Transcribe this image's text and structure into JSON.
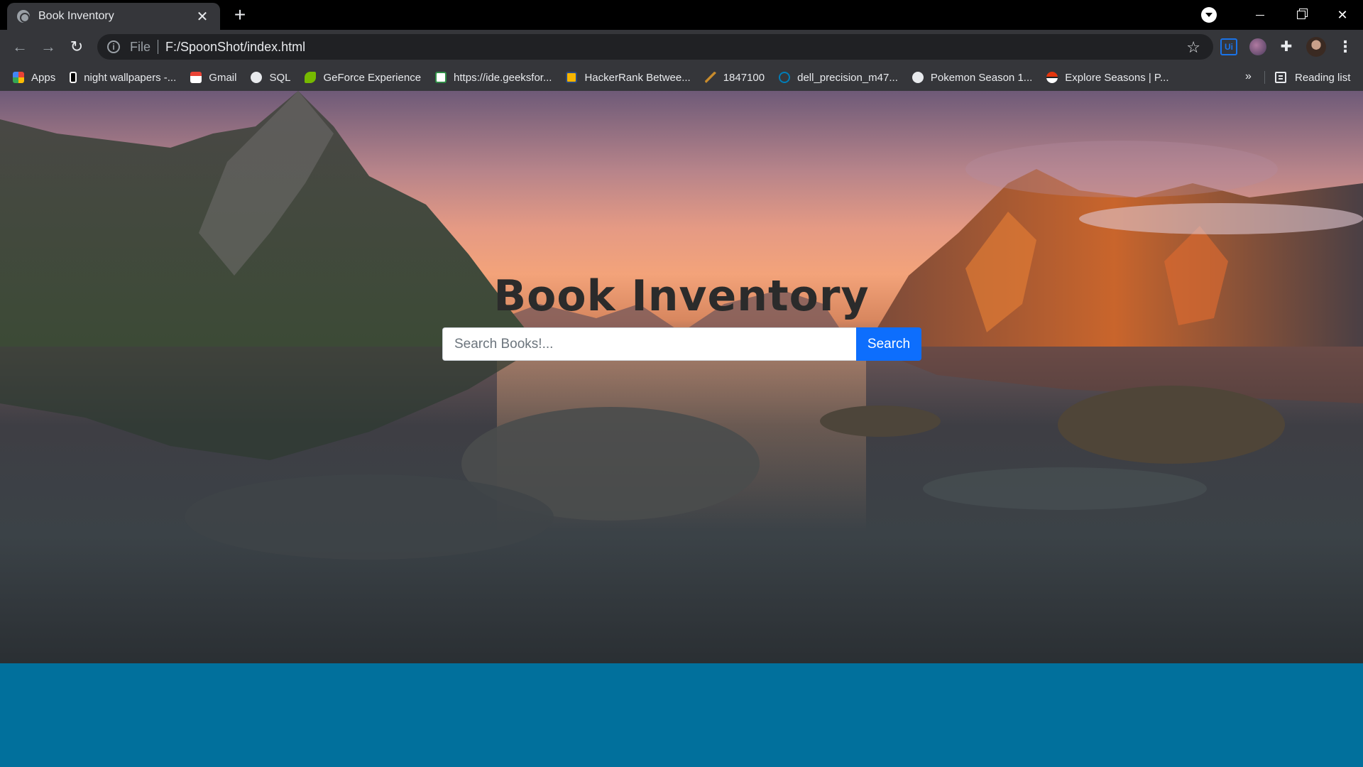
{
  "browser": {
    "tab_title": "Book Inventory",
    "tab_close": "✕",
    "new_tab": "+",
    "url_scheme": "File",
    "url": "F:/SpoonShot/index.html",
    "extension_ui": "Ui"
  },
  "bookmarks": [
    {
      "label": "Apps",
      "icon": "apps-grid-icon",
      "color": "#ea4335"
    },
    {
      "label": "night wallpapers -...",
      "icon": "wallpaper-icon",
      "color": "#ffffff"
    },
    {
      "label": "Gmail",
      "icon": "gmail-icon",
      "color": "#ea4335"
    },
    {
      "label": "SQL",
      "icon": "globe-icon",
      "color": "#e8eaed"
    },
    {
      "label": "GeForce Experience",
      "icon": "nvidia-icon",
      "color": "#76b900"
    },
    {
      "label": "https://ide.geeksfor...",
      "icon": "geeksforgeeks-icon",
      "color": "#2f8d46"
    },
    {
      "label": "HackerRank Betwee...",
      "icon": "hackerrank-icon",
      "color": "#f5b400"
    },
    {
      "label": "1847100",
      "icon": "atcoder-icon",
      "color": "#c78b2c"
    },
    {
      "label": "dell_precision_m47...",
      "icon": "dell-icon",
      "color": "#007db8"
    },
    {
      "label": "Pokemon Season 1...",
      "icon": "globe-icon",
      "color": "#e8eaed"
    },
    {
      "label": "Explore Seasons | P...",
      "icon": "pokeball-icon",
      "color": "#e3350d"
    }
  ],
  "bookmarks_overflow": "»",
  "reading_list": "Reading list",
  "page": {
    "title": "Book Inventory",
    "search_placeholder": "Search Books!...",
    "search_button": "Search"
  },
  "colors": {
    "search_button": "#0d6efd",
    "footer_band": "#01709c"
  }
}
